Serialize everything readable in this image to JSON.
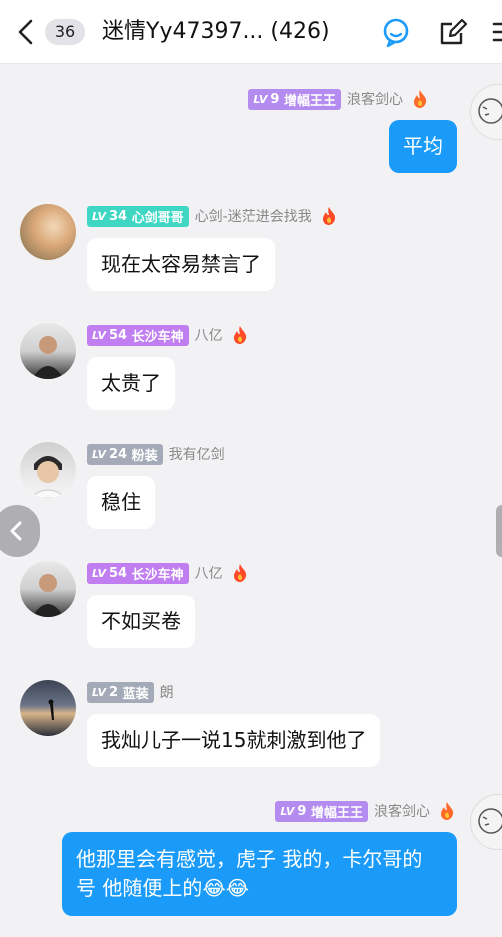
{
  "header": {
    "unread_count": "36",
    "title": "迷情Yy47397... (426)"
  },
  "messages": [
    {
      "direction": "out",
      "level": "9",
      "title": "增幅王王",
      "badge_color": "#b48cf0",
      "nick": "浪客剑心",
      "text": "平均"
    },
    {
      "direction": "in",
      "level": "34",
      "title": "心剑哥哥",
      "badge_color": "#3fd6c4",
      "nick": "心剑-迷茫进会找我",
      "text": "现在太容易禁言了"
    },
    {
      "direction": "in",
      "level": "54",
      "title": "长沙车神",
      "badge_color": "#c07ef0",
      "nick": "八亿",
      "text": "太贵了"
    },
    {
      "direction": "in",
      "level": "24",
      "title": "粉装",
      "badge_color": "#a4aab8",
      "nick": "我有亿剑",
      "text": "稳住"
    },
    {
      "direction": "in",
      "level": "54",
      "title": "长沙车神",
      "badge_color": "#c07ef0",
      "nick": "八亿",
      "text": "不如买卷"
    },
    {
      "direction": "in",
      "level": "2",
      "title": "蓝装",
      "badge_color": "#a4aab8",
      "nick": "朗",
      "text": "我灿儿子一说15就刺激到他了"
    },
    {
      "direction": "out",
      "level": "9",
      "title": "增幅王王",
      "badge_color": "#b48cf0",
      "nick": "浪客剑心",
      "text": "他那里会有感觉，虎子 我的，卡尔哥的 号 他随便上的😂😂"
    }
  ],
  "icons": {
    "back": "chevron-left-icon",
    "chat": "chat-bubble-icon",
    "edit": "edit-icon",
    "menu": "menu-icon",
    "fire": "fire-icon"
  },
  "colors": {
    "accent": "#1a9bf9",
    "background": "#f2f2f4"
  }
}
